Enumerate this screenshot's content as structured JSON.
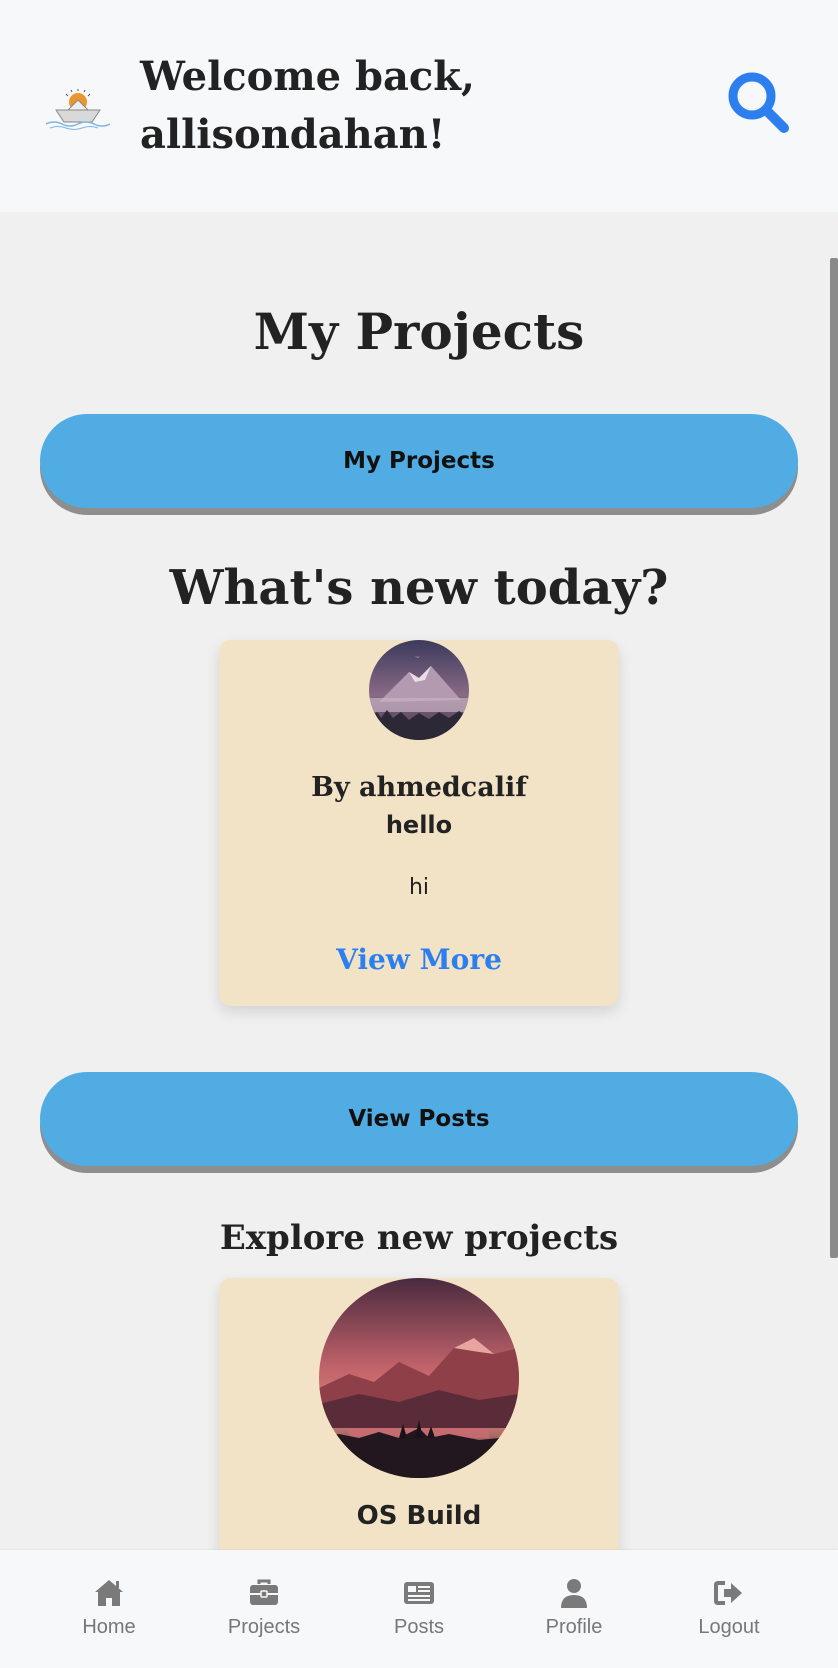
{
  "header": {
    "welcome_line1": "Welcome back,",
    "welcome_line2": "allisondahan!"
  },
  "projects_section": {
    "title": "My Projects",
    "button_label": "My Projects"
  },
  "feed_section": {
    "title": "What's new today?",
    "post": {
      "author": "By ahmedcalif",
      "title": "hello",
      "body": "hi",
      "view_more_label": "View More"
    },
    "button_label": "View Posts"
  },
  "explore_section": {
    "title": "Explore new projects",
    "project": {
      "name": "OS Build"
    }
  },
  "bottom_nav": {
    "items": [
      {
        "label": "Home",
        "icon": "home-icon"
      },
      {
        "label": "Projects",
        "icon": "briefcase-icon"
      },
      {
        "label": "Posts",
        "icon": "newspaper-icon"
      },
      {
        "label": "Profile",
        "icon": "user-icon"
      },
      {
        "label": "Logout",
        "icon": "logout-icon"
      }
    ]
  },
  "colors": {
    "accent_blue": "#51ace4",
    "link_blue": "#2d7ff0",
    "card_bg": "#f2e3c6",
    "page_bg": "#f0f0f0"
  }
}
